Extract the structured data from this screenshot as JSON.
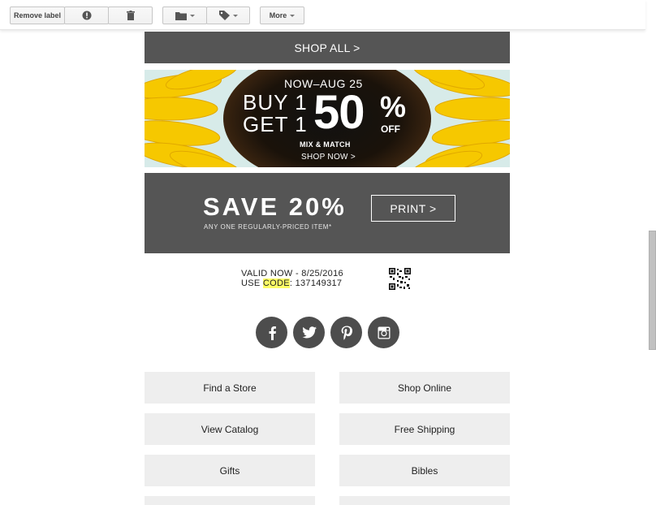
{
  "toolbar": {
    "remove_label": "Remove label",
    "report_icon": "exclamation-circle-icon",
    "delete_icon": "trash-icon",
    "move_icon": "folder-icon",
    "labels_icon": "tag-icon",
    "more_label": "More"
  },
  "email": {
    "shop_all": "SHOP ALL >",
    "promo": {
      "dates": "NOW–AUG 25",
      "buy": "BUY 1",
      "get": "GET 1",
      "percent_number": "50",
      "percent_sign": "%",
      "off": "OFF",
      "mix_match": "MIX & MATCH",
      "shop_now": "SHOP NOW >"
    },
    "coupon": {
      "title": "SAVE 20%",
      "subtitle": "ANY ONE REGULARLY-PRICED ITEM*",
      "print": "PRINT >"
    },
    "validity": {
      "line1": "VALID NOW - 8/25/2016",
      "use": "USE ",
      "code_word": "CODE",
      "code_value": ": 137149317"
    },
    "social": [
      {
        "icon": "facebook-icon"
      },
      {
        "icon": "twitter-icon"
      },
      {
        "icon": "pinterest-icon"
      },
      {
        "icon": "instagram-icon"
      }
    ],
    "links": [
      {
        "label": "Find a Store"
      },
      {
        "label": "Shop Online"
      },
      {
        "label": "View Catalog"
      },
      {
        "label": "Free Shipping"
      },
      {
        "label": "Gifts"
      },
      {
        "label": "Bibles"
      }
    ]
  },
  "colors": {
    "panel_gray": "#555555",
    "link_bg": "#eeeeee",
    "highlight": "#ffff66",
    "banner_bg": "#d7ebe9"
  }
}
